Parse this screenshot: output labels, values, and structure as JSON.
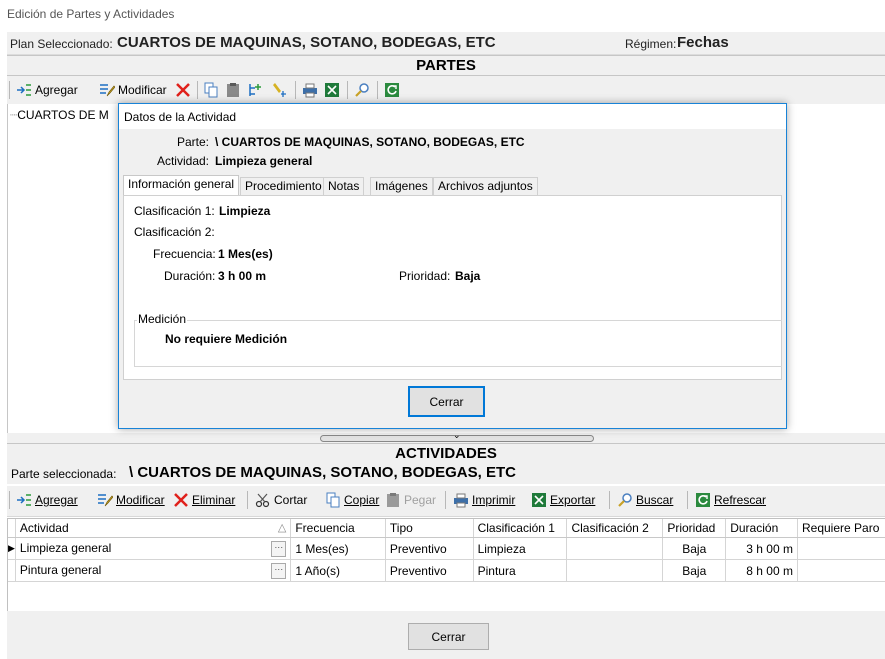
{
  "window": {
    "title": "Edición de Partes y Actividades"
  },
  "plan": {
    "label": "Plan Seleccionado:",
    "value": "CUARTOS DE MAQUINAS, SOTANO, BODEGAS, ETC",
    "regimen_label": "Régimen:",
    "regimen_value": "Fechas"
  },
  "partes": {
    "header": "PARTES",
    "toolbar": {
      "agregar": "Agregar",
      "modificar": "Modificar"
    },
    "tree_node": "CUARTOS DE M"
  },
  "dialog": {
    "title": "Datos de la Actividad",
    "parte_label": "Parte:",
    "parte_value": "\\ CUARTOS DE MAQUINAS, SOTANO, BODEGAS, ETC",
    "actividad_label": "Actividad:",
    "actividad_value": "Limpieza general",
    "tabs": [
      "Información general",
      "Procedimiento",
      "Notas",
      "Imágenes",
      "Archivos adjuntos"
    ],
    "active_tab": "Información general",
    "info": {
      "clasificacion1_label": "Clasificación 1:",
      "clasificacion1_value": "Limpieza",
      "clasificacion2_label": "Clasificación 2:",
      "clasificacion2_value": "",
      "frecuencia_label": "Frecuencia:",
      "frecuencia_value": "1 Mes(es)",
      "duracion_label": "Duración:",
      "duracion_value": "3 h 00 m",
      "prioridad_label": "Prioridad:",
      "prioridad_value": "Baja",
      "medicion_legend": "Medición",
      "medicion_value": "No requiere Medición"
    },
    "close_label": "Cerrar"
  },
  "actividades": {
    "header": "ACTIVIDADES",
    "parte_label": "Parte seleccionada:",
    "parte_value": "\\ CUARTOS DE MAQUINAS, SOTANO, BODEGAS, ETC",
    "toolbar": {
      "agregar": "Agregar",
      "modificar": "Modificar",
      "eliminar": "Eliminar",
      "cortar": "Cortar",
      "copiar": "Copiar",
      "pegar": "Pegar",
      "imprimir": "Imprimir",
      "exportar": "Exportar",
      "buscar": "Buscar",
      "refrescar": "Refrescar"
    },
    "columns": [
      "Actividad",
      "Frecuencia",
      "Tipo",
      "Clasificación 1",
      "Clasificación 2",
      "Prioridad",
      "Duración",
      "Requiere Paro"
    ],
    "sort_indicator": "△",
    "rows": [
      {
        "actividad": "Limpieza general",
        "frecuencia": "1 Mes(es)",
        "tipo": "Preventivo",
        "clasificacion1": "Limpieza",
        "clasificacion2": "",
        "prioridad": "Baja",
        "duracion": "3 h 00 m",
        "requiere_paro": ""
      },
      {
        "actividad": "Pintura general",
        "frecuencia": "1 Año(s)",
        "tipo": "Preventivo",
        "clasificacion1": "Pintura",
        "clasificacion2": "",
        "prioridad": "Baja",
        "duracion": "8 h 00 m",
        "requiere_paro": ""
      }
    ]
  },
  "bottom": {
    "close_label": "Cerrar"
  },
  "colors": {
    "accent": "#0078d7",
    "dialog_border": "#1883d7",
    "panel": "#f0f0f0"
  }
}
